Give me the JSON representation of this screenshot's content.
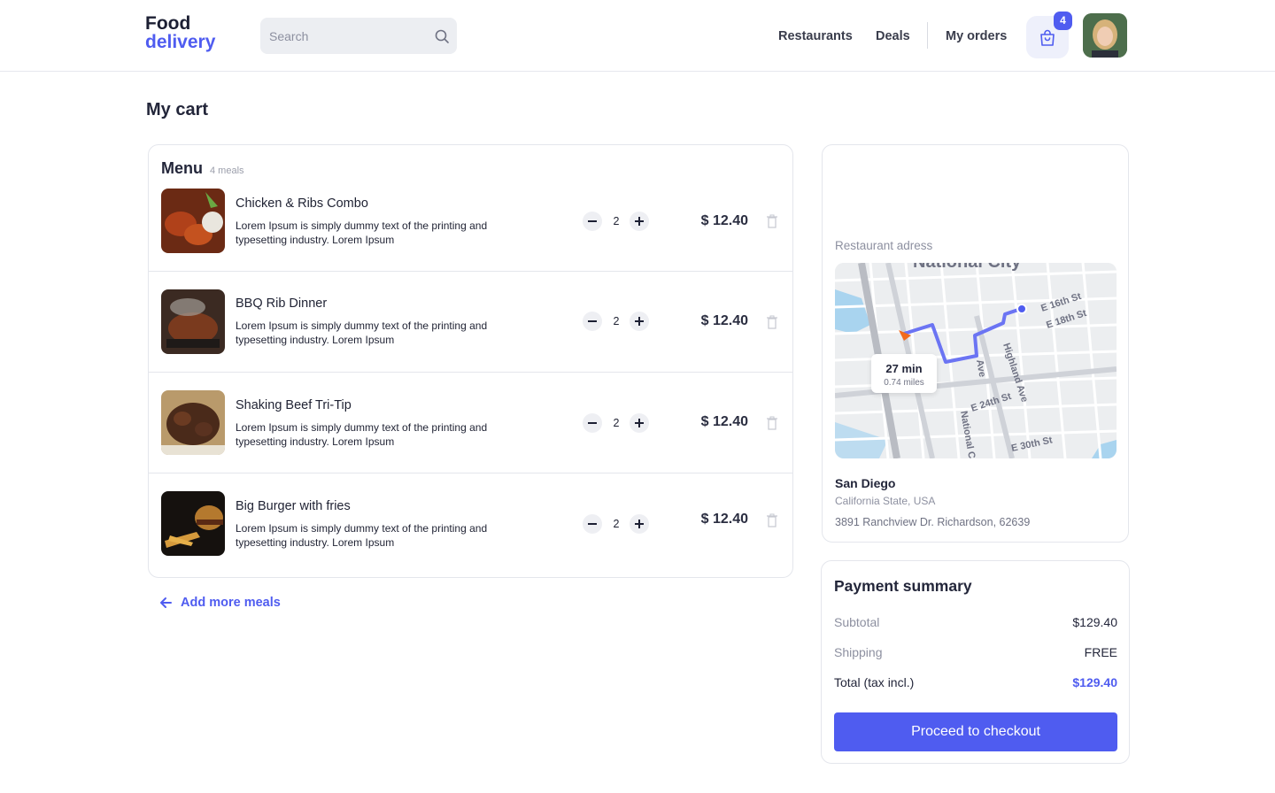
{
  "header": {
    "logo_line1": "Food",
    "logo_line2": "delivery",
    "search_placeholder": "Search",
    "nav": [
      "Restaurants",
      "Deals",
      "My orders"
    ],
    "cart_count": "4"
  },
  "page_title": "My cart",
  "menu": {
    "title": "Menu",
    "count": "4 meals",
    "items": [
      {
        "name": "Chicken & Ribs Combo",
        "desc": "Lorem Ipsum is simply dummy text of the printing and typesetting industry. Lorem Ipsum",
        "qty": "2",
        "price": "$ 12.40"
      },
      {
        "name": "BBQ Rib Dinner",
        "desc": "Lorem Ipsum is simply dummy text of the printing and typesetting industry. Lorem Ipsum",
        "qty": "2",
        "price": "$ 12.40"
      },
      {
        "name": "Shaking Beef Tri-Tip",
        "desc": "Lorem Ipsum is simply dummy text of the printing and typesetting industry. Lorem Ipsum",
        "qty": "2",
        "price": "$ 12.40"
      },
      {
        "name": "Big Burger with fries",
        "desc": "Lorem Ipsum is simply dummy text of the printing and typesetting industry. Lorem Ipsum",
        "qty": "2",
        "price": "$ 12.40"
      }
    ],
    "add_more": "Add more meals"
  },
  "address": {
    "label": "Restaurant adress",
    "eta_time": "27 min",
    "eta_distance": "0.74 miles",
    "map_labels": [
      "National City",
      "E 16th St",
      "E 18th St",
      "Highland Ave",
      "Ave",
      "E 24th St",
      "National C",
      "E 30th St"
    ],
    "city": "San Diego",
    "state": "California State, USA",
    "street": "3891 Ranchview Dr. Richardson, 62639"
  },
  "payment": {
    "title": "Payment summary",
    "subtotal_label": "Subtotal",
    "subtotal_value": "$129.40",
    "shipping_label": "Shipping",
    "shipping_value": "FREE",
    "total_label": "Total (tax incl.)",
    "total_value": "$129.40",
    "checkout_label": "Proceed to checkout"
  },
  "colors": {
    "accent": "#4f5cf0",
    "route": "#6b74f3",
    "origin_marker": "#f26b1d"
  }
}
